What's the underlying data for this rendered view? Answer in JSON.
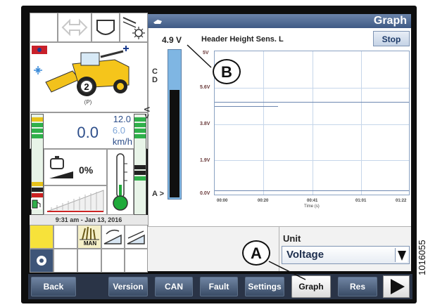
{
  "window": {
    "title": "Graph",
    "stop_label": "Stop"
  },
  "left_panel": {
    "speed_value": "0.0",
    "speed_limit_top": "12.0",
    "speed_limit_mid": "6.0",
    "speed_unit": "km/h",
    "gear": "2",
    "park": "(P)",
    "percent": "0%",
    "datetime": "9:31 am - Jan 13, 2016",
    "man_label": "MAN"
  },
  "graph": {
    "current_value": "4.9 V",
    "sensor_name": "Header Height Sens. L",
    "bar_letters": [
      "C",
      "D"
    ],
    "bar_arrow_mid": "V >",
    "bar_arrow_bottom": "A >",
    "bar_fill_fraction": 0.73,
    "y_ticks": [
      "5.6V",
      "3.8V",
      "1.9V",
      "0.0V"
    ],
    "x_ticks": [
      "00:00",
      "00:20",
      "00:41",
      "01:01",
      "01:22"
    ],
    "x_label": "Time (s)",
    "top_partial_tick": "5V"
  },
  "unit": {
    "label": "Unit",
    "value": "Voltage"
  },
  "toolbar": {
    "back": "Back",
    "version": "Version",
    "can": "CAN",
    "fault": "Fault",
    "settings": "Settings",
    "graph": "Graph",
    "res": "Res"
  },
  "callouts": {
    "a": "A",
    "b": "B"
  },
  "figure_id": "1016055",
  "colors": {
    "accent": "#5573a3",
    "bar_fill": "#101010",
    "bar_bg": "#7fb6e3",
    "gauge_green": "#1faa3a"
  }
}
